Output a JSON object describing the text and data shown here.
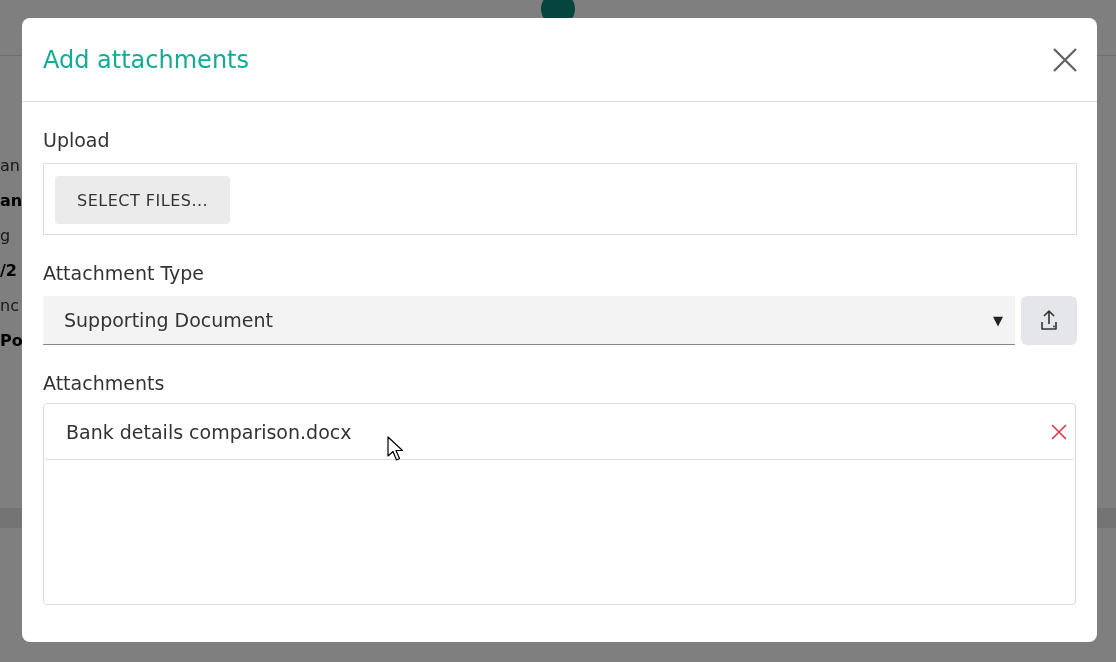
{
  "background": {
    "fragments": [
      {
        "text": "an",
        "kind": "label"
      },
      {
        "text": "an",
        "kind": "value"
      },
      {
        "text": "g",
        "kind": "label"
      },
      {
        "text": "/2",
        "kind": "value"
      },
      {
        "text": "nc",
        "kind": "label"
      },
      {
        "text": "Po",
        "kind": "value"
      }
    ]
  },
  "dialog": {
    "title": "Add attachments",
    "upload": {
      "label": "Upload",
      "button": "SELECT FILES..."
    },
    "attachment_type": {
      "label": "Attachment Type",
      "value": "Supporting Document",
      "caret": "▼"
    },
    "attachments": {
      "label": "Attachments",
      "items": [
        {
          "name": "Bank details comparison.docx"
        }
      ]
    }
  }
}
